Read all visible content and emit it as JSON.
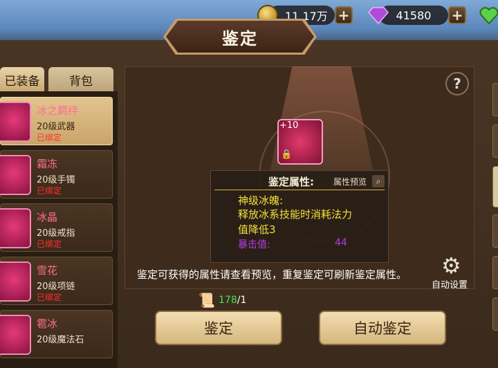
{
  "currency": {
    "gold": "11.17万",
    "gems": "41580"
  },
  "title": "鉴定",
  "tabs": {
    "equipped": "已装备",
    "bag": "背包"
  },
  "items": [
    {
      "name": "冰之羁绊",
      "level": "20级武器",
      "status": "已绑定"
    },
    {
      "name": "霜冻",
      "level": "20级手镯",
      "status": "已绑定"
    },
    {
      "name": "冰晶",
      "level": "20级戒指",
      "status": "已绑定"
    },
    {
      "name": "雪花",
      "level": "20级项链",
      "status": "已绑定"
    },
    {
      "name": "雹冰",
      "level": "20级魔法石",
      "status": ""
    }
  ],
  "selected_item": {
    "enhance": "+10"
  },
  "attributes": {
    "title": "鉴定属性:",
    "preview_label": "属性预览",
    "line1": "神级冰魄:",
    "line2": "释放冰系技能时消耗法力",
    "line3": "值降低3",
    "crit_label": "暴击值:",
    "crit_value": "44"
  },
  "note": "鉴定可获得的属性请查看预览，重复鉴定可刷新鉴定属性。",
  "auto_settings": "自动设置",
  "scroll_count": {
    "have": "178",
    "need": "/1"
  },
  "buttons": {
    "identify": "鉴定",
    "auto_identify": "自动鉴定"
  },
  "colors": {
    "accent": "#c59b6a",
    "item_name": "#ff6e8e",
    "bound": "#ff3030",
    "attr_yellow": "#f3e03c",
    "attr_purple": "#b23ee0",
    "count_green": "#4fe04f"
  }
}
